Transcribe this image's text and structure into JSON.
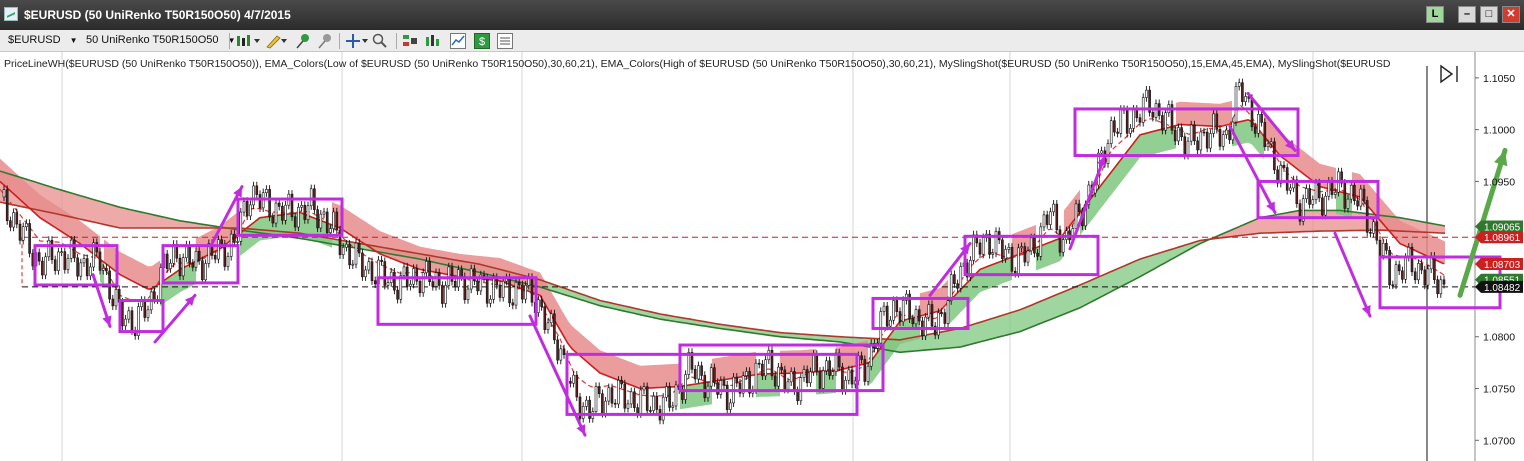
{
  "window": {
    "title": "$EURUSD (50 UniRenko T50R150O50)  4/7/2015",
    "link_label": "L",
    "minimize": "–",
    "maximize": "□",
    "close": "✕"
  },
  "toolbar": {
    "symbol": "$EURUSD",
    "bar_type": "50 UniRenko T50R150O50",
    "icons": [
      "bar-style-icon",
      "pencil-icon",
      "pin-icon",
      "pin-gray-icon",
      "crosshair-icon",
      "zoom-icon",
      "trade-icon",
      "bars-icon",
      "chart-icon",
      "dollar-icon",
      "list-icon"
    ]
  },
  "legend_text": "PriceLineWH($EURUSD (50 UniRenko T50R150O50)), EMA_Colors(Low of $EURUSD (50 UniRenko T50R150O50),30,60,21), EMA_Colors(High of $EURUSD (50 UniRenko T50R150O50),30,60,21), MySlingShot($EURUSD (50 UniRenko T50R150O50),15,EMA,45,EMA), MySlingShot($EURUSD",
  "colors": {
    "up_band": "#7fc77f",
    "down_band": "#e88c8c",
    "fast_red": "#cc1f1f",
    "slow_green": "#2f7a2f",
    "slow_red": "#b2362a",
    "annotation": "#c02ce0",
    "green_arrow": "#5aa84a"
  },
  "chart_data": {
    "type": "candlestick",
    "symbol": "$EURUSD",
    "ylim": [
      1.068,
      1.1075
    ],
    "y_ticks": [
      "1.1050",
      "1.1000",
      "1.0950",
      "1.0800",
      "1.0750",
      "1.0700"
    ],
    "price_labels": [
      {
        "label": "1.09065",
        "value": 1.09065,
        "color": "#2f7a2f"
      },
      {
        "label": "1.08961",
        "value": 1.08961,
        "color": "#cc1f1f"
      },
      {
        "label": "1.08703",
        "value": 1.08703,
        "color": "#cc1f1f"
      },
      {
        "label": "1.08551",
        "value": 1.08551,
        "color": "#2f7a2f"
      },
      {
        "label": "1.08482",
        "value": 1.08482,
        "color": "#111111"
      }
    ],
    "reference_lines": [
      {
        "value": 1.08961,
        "style": "dashed",
        "color": "#cc1f1f"
      },
      {
        "value": 1.08482,
        "style": "dashed",
        "color": "#111111"
      }
    ],
    "price_path": [
      [
        0,
        1.0935
      ],
      [
        25,
        1.0895
      ],
      [
        40,
        1.087
      ],
      [
        60,
        1.088
      ],
      [
        80,
        1.087
      ],
      [
        100,
        1.0875
      ],
      [
        120,
        1.082
      ],
      [
        135,
        1.0815
      ],
      [
        150,
        1.083
      ],
      [
        160,
        1.086
      ],
      [
        175,
        1.088
      ],
      [
        195,
        1.087
      ],
      [
        215,
        1.088
      ],
      [
        235,
        1.089
      ],
      [
        250,
        1.094
      ],
      [
        270,
        1.0925
      ],
      [
        290,
        1.092
      ],
      [
        310,
        1.0925
      ],
      [
        325,
        1.0915
      ],
      [
        345,
        1.0885
      ],
      [
        360,
        1.087
      ],
      [
        380,
        1.086
      ],
      [
        400,
        1.085
      ],
      [
        420,
        1.086
      ],
      [
        440,
        1.085
      ],
      [
        460,
        1.0855
      ],
      [
        480,
        1.085
      ],
      [
        500,
        1.0845
      ],
      [
        520,
        1.0845
      ],
      [
        535,
        1.084
      ],
      [
        545,
        1.0815
      ],
      [
        560,
        1.079
      ],
      [
        575,
        1.074
      ],
      [
        590,
        1.073
      ],
      [
        610,
        1.0745
      ],
      [
        630,
        1.074
      ],
      [
        650,
        1.0735
      ],
      [
        670,
        1.0735
      ],
      [
        690,
        1.077
      ],
      [
        710,
        1.0755
      ],
      [
        730,
        1.0745
      ],
      [
        750,
        1.076
      ],
      [
        770,
        1.0775
      ],
      [
        790,
        1.075
      ],
      [
        810,
        1.0765
      ],
      [
        830,
        1.077
      ],
      [
        850,
        1.076
      ],
      [
        865,
        1.077
      ],
      [
        880,
        1.081
      ],
      [
        895,
        1.083
      ],
      [
        915,
        1.082
      ],
      [
        935,
        1.081
      ],
      [
        950,
        1.084
      ],
      [
        970,
        1.088
      ],
      [
        990,
        1.0895
      ],
      [
        1010,
        1.0875
      ],
      [
        1030,
        1.088
      ],
      [
        1050,
        1.092
      ],
      [
        1065,
        1.089
      ],
      [
        1080,
        1.092
      ],
      [
        1095,
        1.095
      ],
      [
        1110,
        1.1
      ],
      [
        1130,
        1.101
      ],
      [
        1150,
        1.1025
      ],
      [
        1170,
        1.1005
      ],
      [
        1190,
        1.0985
      ],
      [
        1210,
        1.1
      ],
      [
        1225,
        1.099
      ],
      [
        1240,
        1.104
      ],
      [
        1255,
        1.101
      ],
      [
        1270,
        1.098
      ],
      [
        1285,
        1.095
      ],
      [
        1300,
        1.093
      ],
      [
        1320,
        1.0935
      ],
      [
        1340,
        1.0945
      ],
      [
        1360,
        1.093
      ],
      [
        1375,
        1.09
      ],
      [
        1390,
        1.086
      ],
      [
        1410,
        1.087
      ],
      [
        1430,
        1.086
      ],
      [
        1445,
        1.0848
      ]
    ],
    "ema_fast": [
      [
        0,
        1.095
      ],
      [
        40,
        1.0915
      ],
      [
        80,
        1.089
      ],
      [
        120,
        1.086
      ],
      [
        150,
        1.0845
      ],
      [
        180,
        1.0865
      ],
      [
        220,
        1.0885
      ],
      [
        260,
        1.0915
      ],
      [
        300,
        1.092
      ],
      [
        340,
        1.0905
      ],
      [
        380,
        1.088
      ],
      [
        420,
        1.0865
      ],
      [
        460,
        1.0858
      ],
      [
        500,
        1.0854
      ],
      [
        540,
        1.084
      ],
      [
        570,
        1.079
      ],
      [
        600,
        1.0765
      ],
      [
        640,
        1.075
      ],
      [
        680,
        1.0752
      ],
      [
        720,
        1.0758
      ],
      [
        760,
        1.0764
      ],
      [
        800,
        1.0765
      ],
      [
        840,
        1.0768
      ],
      [
        870,
        1.0775
      ],
      [
        900,
        1.0815
      ],
      [
        940,
        1.0825
      ],
      [
        980,
        1.0865
      ],
      [
        1020,
        1.088
      ],
      [
        1060,
        1.0895
      ],
      [
        1100,
        1.0945
      ],
      [
        1140,
        1.0995
      ],
      [
        1180,
        1.1005
      ],
      [
        1220,
        1.1003
      ],
      [
        1250,
        1.101
      ],
      [
        1280,
        1.0975
      ],
      [
        1320,
        1.0945
      ],
      [
        1360,
        1.0935
      ],
      [
        1400,
        1.089
      ],
      [
        1445,
        1.087
      ]
    ],
    "ema_slow": [
      [
        0,
        1.093
      ],
      [
        60,
        1.0918
      ],
      [
        120,
        1.0905
      ],
      [
        180,
        1.0905
      ],
      [
        240,
        1.0905
      ],
      [
        300,
        1.09
      ],
      [
        360,
        1.089
      ],
      [
        420,
        1.088
      ],
      [
        480,
        1.087
      ],
      [
        540,
        1.0855
      ],
      [
        600,
        1.0835
      ],
      [
        660,
        1.0822
      ],
      [
        720,
        1.0812
      ],
      [
        780,
        1.0804
      ],
      [
        840,
        1.08
      ],
      [
        900,
        1.0797
      ],
      [
        960,
        1.0808
      ],
      [
        1020,
        1.0826
      ],
      [
        1080,
        1.085
      ],
      [
        1140,
        1.0875
      ],
      [
        1200,
        1.0893
      ],
      [
        1260,
        1.09
      ],
      [
        1320,
        1.0902
      ],
      [
        1380,
        1.0903
      ],
      [
        1445,
        1.09
      ]
    ],
    "ema_long": [
      [
        0,
        1.096
      ],
      [
        60,
        1.0942
      ],
      [
        120,
        1.0925
      ],
      [
        180,
        1.0912
      ],
      [
        240,
        1.0903
      ],
      [
        300,
        1.0895
      ],
      [
        360,
        1.0885
      ],
      [
        420,
        1.0875
      ],
      [
        480,
        1.0862
      ],
      [
        540,
        1.0848
      ],
      [
        600,
        1.083
      ],
      [
        660,
        1.0817
      ],
      [
        720,
        1.0808
      ],
      [
        780,
        1.08
      ],
      [
        840,
        1.0795
      ],
      [
        900,
        1.0785
      ],
      [
        960,
        1.079
      ],
      [
        1020,
        1.0805
      ],
      [
        1080,
        1.0828
      ],
      [
        1140,
        1.0858
      ],
      [
        1200,
        1.089
      ],
      [
        1260,
        1.0915
      ],
      [
        1300,
        1.0922
      ],
      [
        1340,
        1.0922
      ],
      [
        1400,
        1.0915
      ],
      [
        1445,
        1.0907
      ]
    ],
    "annotation_boxes": [
      {
        "t0": 35,
        "t1": 117,
        "p0": 1.0888,
        "p1": 1.085
      },
      {
        "t0": 120,
        "t1": 163,
        "p0": 1.0835,
        "p1": 1.0805
      },
      {
        "t0": 163,
        "t1": 238,
        "p0": 1.0888,
        "p1": 1.0852
      },
      {
        "t0": 238,
        "t1": 342,
        "p0": 1.0933,
        "p1": 1.0898
      },
      {
        "t0": 378,
        "t1": 536,
        "p0": 1.0857,
        "p1": 1.0812
      },
      {
        "t0": 567,
        "t1": 857,
        "p0": 1.0783,
        "p1": 1.0725
      },
      {
        "t0": 680,
        "t1": 883,
        "p0": 1.0792,
        "p1": 1.0748
      },
      {
        "t0": 873,
        "t1": 968,
        "p0": 1.0837,
        "p1": 1.0808
      },
      {
        "t0": 965,
        "t1": 1098,
        "p0": 1.0897,
        "p1": 1.086
      },
      {
        "t0": 1075,
        "t1": 1298,
        "p0": 1.102,
        "p1": 1.0975
      },
      {
        "t0": 1258,
        "t1": 1378,
        "p0": 1.095,
        "p1": 1.0915
      },
      {
        "t0": 1380,
        "t1": 1500,
        "p0": 1.0877,
        "p1": 1.0828
      }
    ],
    "annotation_arrows": [
      {
        "from": [
          93,
          1.086
        ],
        "to": [
          110,
          1.081
        ],
        "color": "#c02ce0"
      },
      {
        "from": [
          155,
          1.0795
        ],
        "to": [
          195,
          1.084
        ],
        "color": "#c02ce0"
      },
      {
        "from": [
          212,
          1.089
        ],
        "to": [
          242,
          1.0945
        ],
        "color": "#c02ce0"
      },
      {
        "from": [
          530,
          1.082
        ],
        "to": [
          585,
          1.0705
        ],
        "color": "#c02ce0"
      },
      {
        "from": [
          930,
          1.084
        ],
        "to": [
          970,
          1.089
        ],
        "color": "#c02ce0"
      },
      {
        "from": [
          1070,
          1.0885
        ],
        "to": [
          1105,
          1.0975
        ],
        "color": "#c02ce0"
      },
      {
        "from": [
          1248,
          1.1035
        ],
        "to": [
          1295,
          1.098
        ],
        "color": "#c02ce0"
      },
      {
        "from": [
          1230,
          1.1003
        ],
        "to": [
          1275,
          1.092
        ],
        "color": "#c02ce0"
      },
      {
        "from": [
          1335,
          1.09
        ],
        "to": [
          1370,
          1.082
        ],
        "color": "#c02ce0"
      },
      {
        "from": [
          1460,
          1.084
        ],
        "to": [
          1505,
          1.098
        ],
        "color": "#5aa84a"
      }
    ]
  }
}
